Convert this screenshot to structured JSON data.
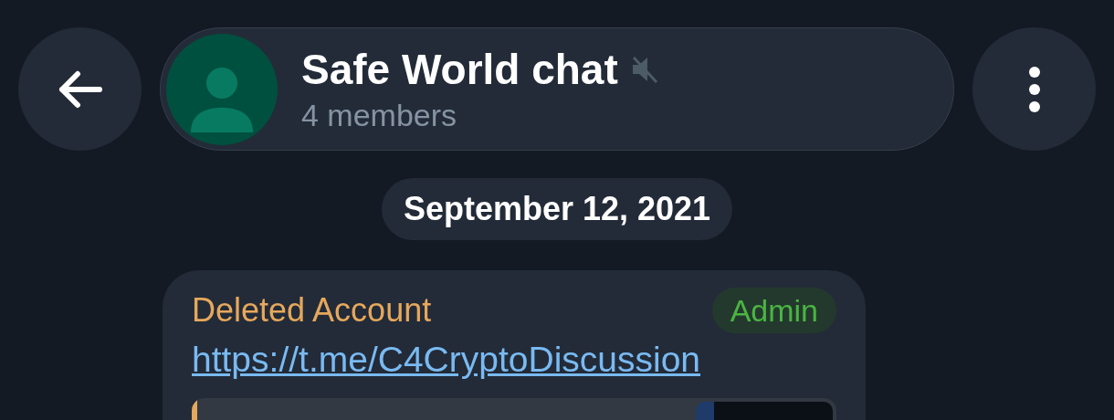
{
  "header": {
    "title": "Safe World chat",
    "muted": true,
    "subtitle": "4 members"
  },
  "date_separator": "September 12, 2021",
  "message": {
    "sender": "Deleted Account",
    "badge": "Admin",
    "link": "https://t.me/C4CryptoDiscussion"
  }
}
